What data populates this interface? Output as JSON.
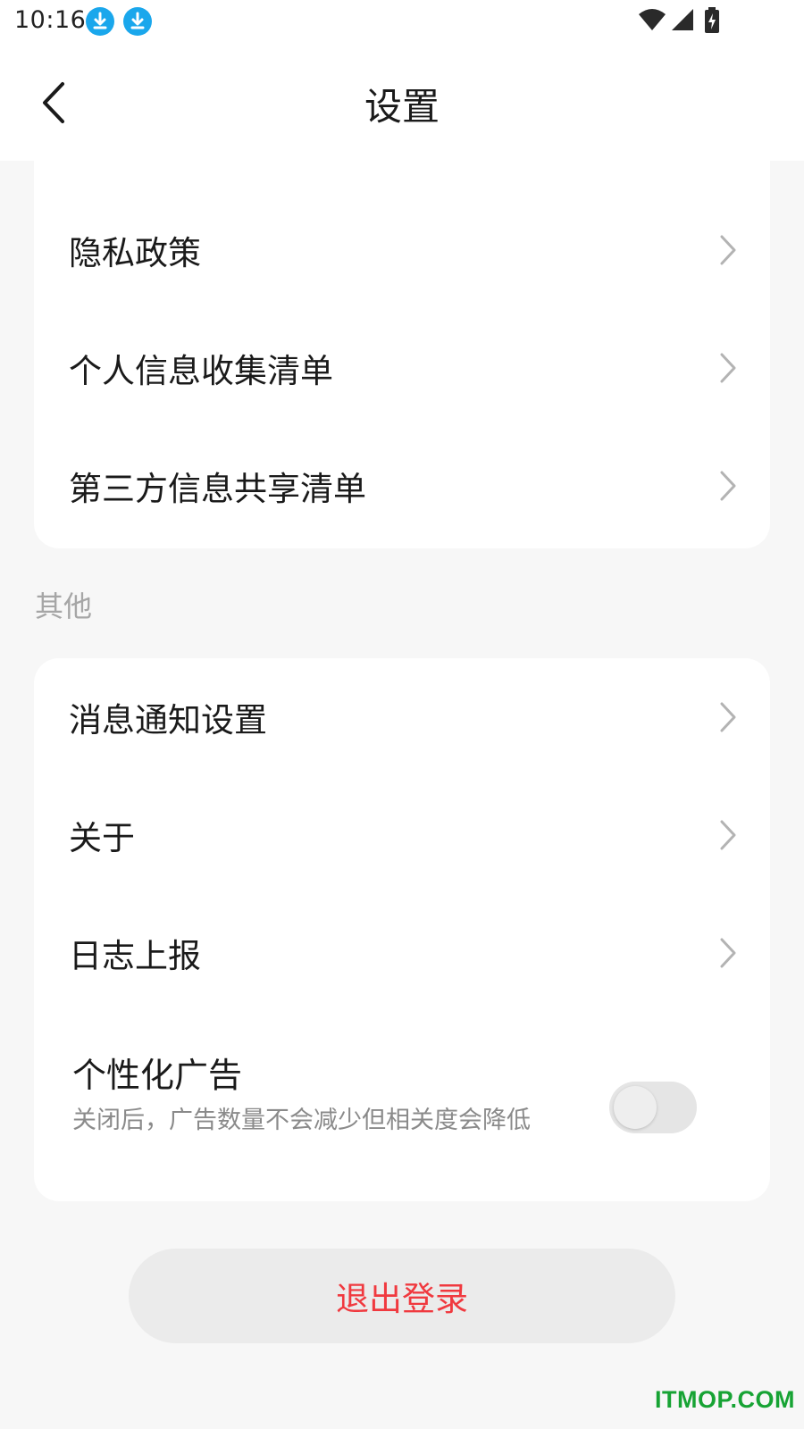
{
  "status_bar": {
    "time": "10:16",
    "left_icons": [
      "download-icon",
      "download-icon"
    ],
    "right_icons": [
      "wifi-icon",
      "cellular-signal-icon",
      "battery-charging-icon"
    ]
  },
  "header": {
    "back_icon": "chevron-left-icon",
    "title": "设置"
  },
  "privacy_card": {
    "items": [
      {
        "label": "隐私政策"
      },
      {
        "label": "个人信息收集清单"
      },
      {
        "label": "第三方信息共享清单"
      }
    ]
  },
  "other_section": {
    "label": "其他",
    "items": [
      {
        "label": "消息通知设置"
      },
      {
        "label": "关于"
      },
      {
        "label": "日志上报"
      }
    ],
    "personalized_ads": {
      "title": "个性化广告",
      "description": "关闭后，广告数量不会减少但相关度会降低",
      "enabled": false
    }
  },
  "logout": {
    "label": "退出登录"
  },
  "watermark": "ITMOP.COM",
  "colors": {
    "background": "#f7f7f7",
    "card": "#ffffff",
    "accent_red": "#f0393f",
    "download_icon_blue": "#1aa7ec",
    "watermark_green": "#17a334"
  }
}
